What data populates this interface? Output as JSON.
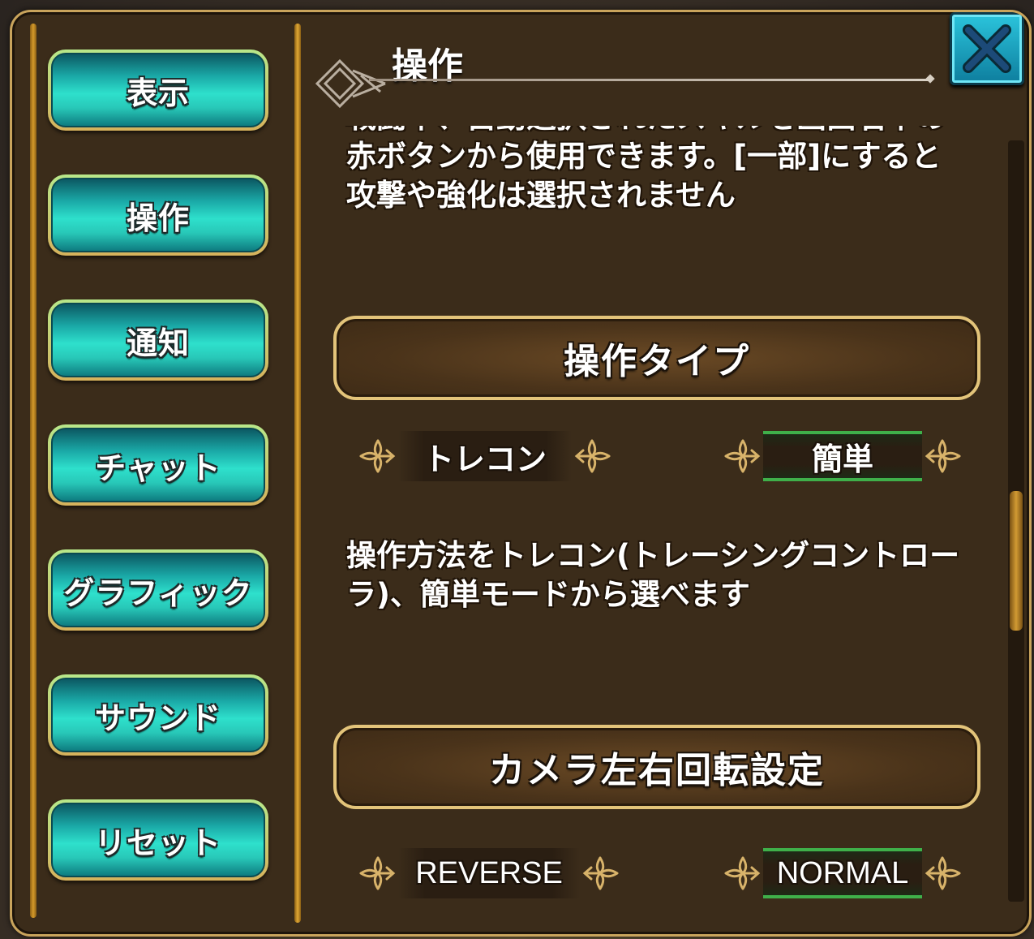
{
  "header": {
    "title": "操作"
  },
  "sidebar": {
    "tabs": [
      {
        "label": "表示"
      },
      {
        "label": "操作"
      },
      {
        "label": "通知"
      },
      {
        "label": "チャット"
      },
      {
        "label": "グラフィック"
      },
      {
        "label": "サウンド"
      },
      {
        "label": "リセット"
      }
    ]
  },
  "content": {
    "partial_description": "戦闘中、自動選択されたスキルを画面右下の赤ボタンから使用できます。[一部]にすると攻撃や強化は選択されません",
    "sections": [
      {
        "title": "操作タイプ",
        "options": [
          {
            "label": "トレコン",
            "selected": false
          },
          {
            "label": "簡単",
            "selected": true
          }
        ],
        "description": "操作方法をトレコン(トレーシングコントローラ)、簡単モードから選べます"
      },
      {
        "title": "カメラ左右回転設定",
        "options": [
          {
            "label": "REVERSE",
            "selected": false
          },
          {
            "label": "NORMAL",
            "selected": true
          }
        ]
      }
    ]
  },
  "colors": {
    "panel_bg": "#3b2c1a",
    "gold_border": "#c9a45c",
    "tab_teal": "#2ee0cc",
    "selected_green": "#3fb04a",
    "close_blue": "#2bc4dc"
  },
  "icons": {
    "close": "close-x-icon",
    "ornament": "fleur-ornament-icon",
    "emblem": "diamond-emblem-icon"
  }
}
